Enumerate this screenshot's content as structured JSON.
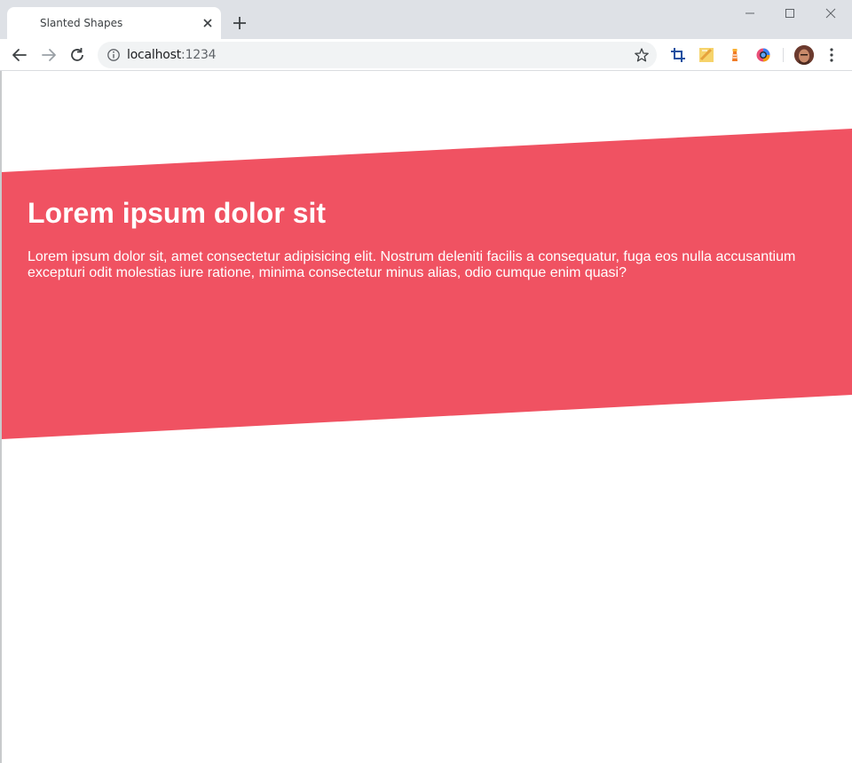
{
  "window": {
    "tab_title": "Slanted Shapes"
  },
  "toolbar": {
    "url_host": "localhost",
    "url_port": ":1234"
  },
  "page": {
    "headline": "Lorem ipsum dolor sit",
    "body": "Lorem ipsum dolor sit, amet consectetur adipisicing elit. Nostrum deleniti facilis a consequatur, fuga eos nulla accusantium excepturi odit molestias iure ratione, minima consectetur minus alias, odio cumque enim quasi?"
  },
  "colors": {
    "accent": "#f05262",
    "tabbar": "#dee1e6",
    "omnibox": "#f1f3f4"
  },
  "icons": {
    "back": "back-arrow-icon",
    "forward": "forward-arrow-icon",
    "reload": "reload-icon",
    "info": "info-icon",
    "star": "star-icon",
    "new_tab": "plus-icon",
    "close_tab": "close-icon",
    "menu": "vertical-dots-icon"
  }
}
